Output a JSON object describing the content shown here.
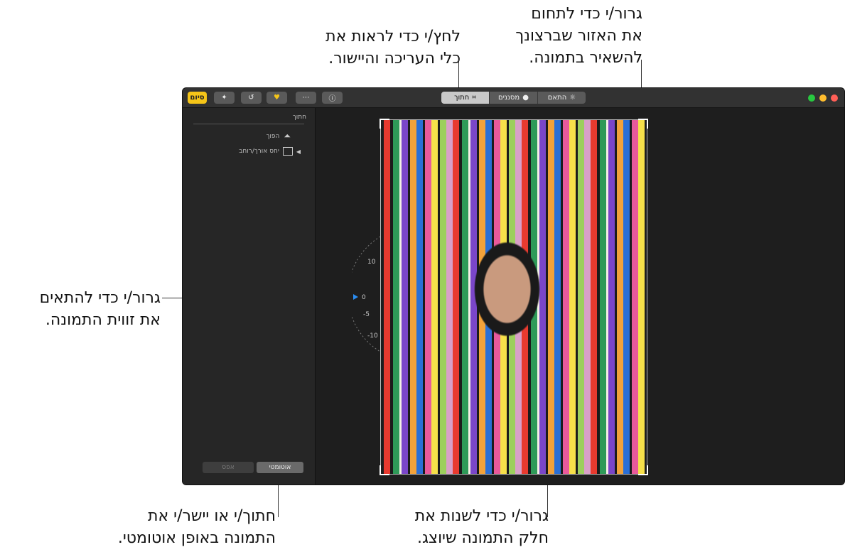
{
  "callouts": {
    "top_center": "לחץ/י כדי לראות את\nכלי העריכה והיישור.",
    "top_right": "גרור/י כדי לתחום\nאת האזור שברצונך\nלהשאיר בתמונה.",
    "left": "גרור/י כדי להתאים\nאת זווית התמונה.",
    "bottom_left": "חתוך/י או יישר/י את\nהתמונה באופן אוטומטי.",
    "bottom_center": "גרור/י כדי לשנות את\nחלק התמונה שיוצג."
  },
  "toolbar": {
    "done_label": "סיום",
    "tabs": [
      {
        "label": "חתוך",
        "active": true,
        "icon": "crop-icon"
      },
      {
        "label": "מסננים",
        "active": false,
        "icon": "filters-icon"
      },
      {
        "label": "התאם",
        "active": false,
        "icon": "adjust-icon"
      }
    ],
    "icons": [
      "magic-wand-icon",
      "rotate-icon",
      "heart-icon",
      "more-icon",
      "info-icon"
    ]
  },
  "sidebar": {
    "section_title": "חתוך",
    "flip_label": "הפוך",
    "aspect_label": "יחס אורך/רוחב",
    "auto_button": "אוטומטי",
    "reset_button": "אפס"
  },
  "dial": {
    "ticks": [
      "10",
      "0",
      "-5",
      "-10"
    ]
  },
  "colors": {
    "done_button": "#f5c518",
    "window_bg": "#1e1e1e",
    "traffic_close": "#ff5f57",
    "traffic_min": "#febc2e",
    "traffic_max": "#28c840"
  }
}
